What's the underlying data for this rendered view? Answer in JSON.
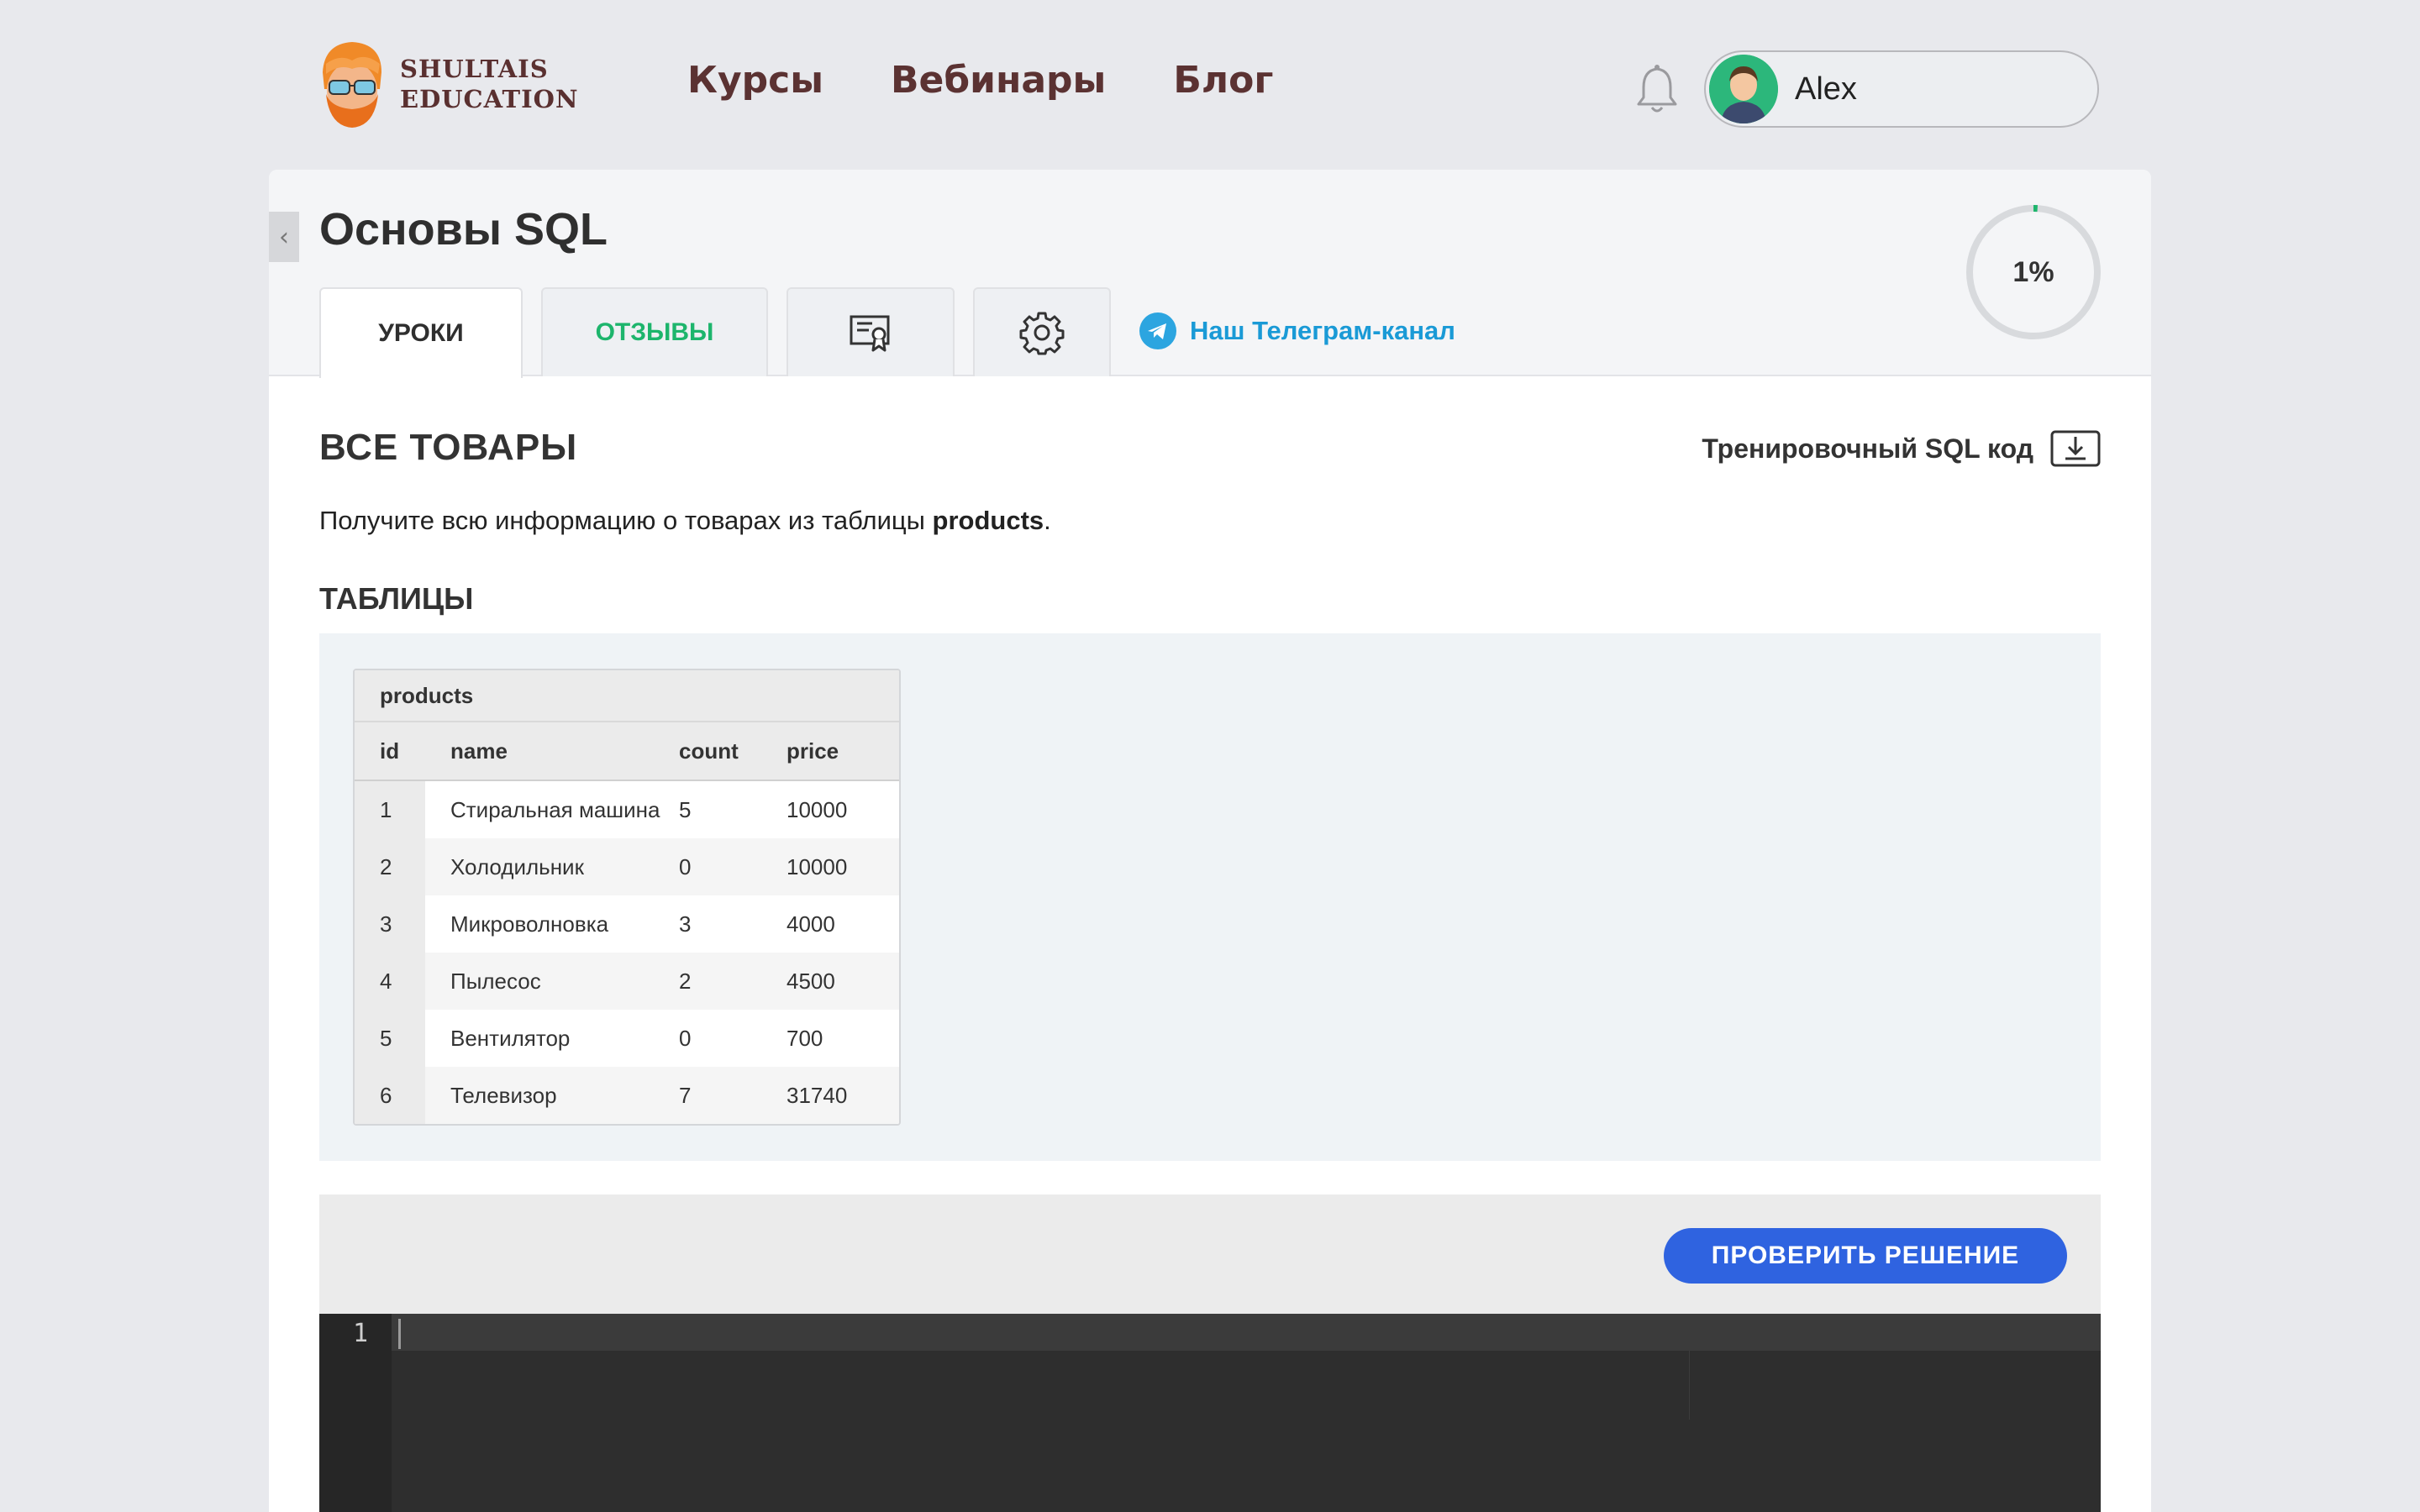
{
  "header": {
    "logo": {
      "line1": "SHULTAIS",
      "line2": "EDUCATION"
    },
    "nav": [
      {
        "label": "Курсы"
      },
      {
        "label": "Вебинары"
      },
      {
        "label": "Блог"
      }
    ],
    "user": {
      "name": "Alex"
    }
  },
  "course": {
    "back_icon": "‹",
    "title": "Основы SQL",
    "tabs": {
      "lessons": "УРОКИ",
      "reviews": "ОТЗЫВЫ",
      "certificate_icon": "certificate-icon",
      "settings_icon": "gear-icon"
    },
    "telegram": {
      "label": "Наш Телеграм-канал"
    },
    "progress": {
      "value": 1,
      "label": "1%"
    }
  },
  "lesson": {
    "title": "ВСЕ ТОВАРЫ",
    "training_link": "Тренировочный SQL код",
    "task_prefix": "Получите всю информацию о товарах из таблицы ",
    "task_table": "products",
    "task_suffix": ".",
    "tables_heading": "ТАБЛИЦЫ"
  },
  "table": {
    "name": "products",
    "columns": {
      "id": "id",
      "name": "name",
      "count": "count",
      "price": "price"
    },
    "rows": [
      {
        "id": "1",
        "name": "Стиральная машина",
        "count": "5",
        "price": "10000"
      },
      {
        "id": "2",
        "name": "Холодильник",
        "count": "0",
        "price": "10000"
      },
      {
        "id": "3",
        "name": "Микроволновка",
        "count": "3",
        "price": "4000"
      },
      {
        "id": "4",
        "name": "Пылесос",
        "count": "2",
        "price": "4500"
      },
      {
        "id": "5",
        "name": "Вентилятор",
        "count": "0",
        "price": "700"
      },
      {
        "id": "6",
        "name": "Телевизор",
        "count": "7",
        "price": "31740"
      }
    ]
  },
  "editor": {
    "check_button": "ПРОВЕРИТЬ РЕШЕНИЕ",
    "line_number": "1"
  },
  "colors": {
    "accent_green": "#1db56c",
    "telegram_blue": "#2ca5e0",
    "button_blue": "#2f63e0",
    "nav_brown": "#5b3232"
  }
}
